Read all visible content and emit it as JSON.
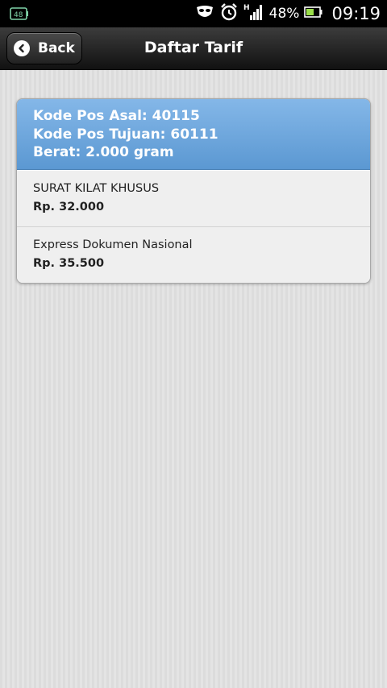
{
  "status_bar": {
    "battery_percent": "48%",
    "time": "09:19",
    "network_indicator": "H",
    "icons": [
      "sd-card-icon",
      "mask-icon",
      "alarm-icon",
      "signal-icon",
      "battery-icon"
    ]
  },
  "header": {
    "back_label": "Back",
    "title": "Daftar Tarif"
  },
  "card": {
    "header_lines": [
      "Kode Pos Asal: 40115",
      "Kode Pos Tujuan: 60111",
      "Berat: 2.000 gram"
    ],
    "items": [
      {
        "name": "SURAT KILAT KHUSUS",
        "price": "Rp. 32.000"
      },
      {
        "name": "Express Dokumen Nasional",
        "price": "Rp. 35.500"
      }
    ]
  },
  "colors": {
    "card_header_top": "#84b7e8",
    "card_header_bottom": "#5b98d2",
    "toolbar": "#1e1e1e"
  }
}
